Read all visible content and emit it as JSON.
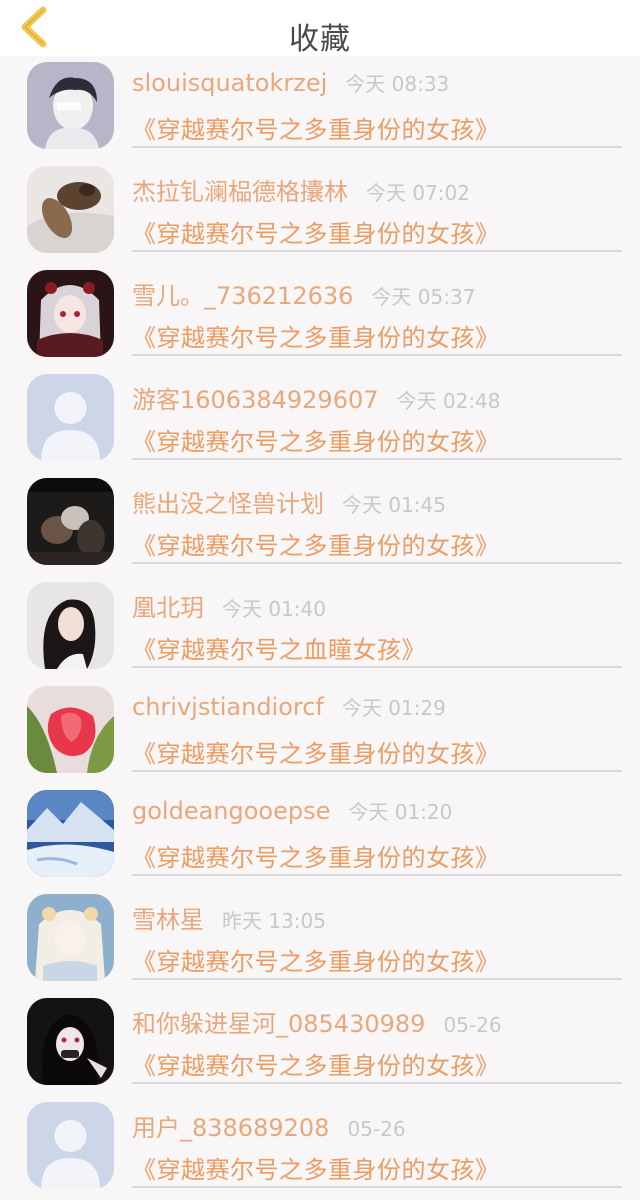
{
  "header": {
    "title": "收藏"
  },
  "favorites": [
    {
      "name": "slouisquatokrzej",
      "time": "今天 08:33",
      "book": "《穿越赛尔号之多重身份的女孩》",
      "avatar": "anime-boy"
    },
    {
      "name": "杰拉钆澜榀德格攮林",
      "time": "今天 07:02",
      "book": "《穿越赛尔号之多重身份的女孩》",
      "avatar": "cat-photo"
    },
    {
      "name": "雪儿。_736212636",
      "time": "今天 05:37",
      "book": "《穿越赛尔号之多重身份的女孩》",
      "avatar": "anime-girl-red"
    },
    {
      "name": "游客1606384929607",
      "time": "今天 02:48",
      "book": "《穿越赛尔号之多重身份的女孩》",
      "avatar": "default-user"
    },
    {
      "name": "熊出没之怪兽计划",
      "time": "今天 01:45",
      "book": "《穿越赛尔号之多重身份的女孩》",
      "avatar": "movie-still"
    },
    {
      "name": "凰北玥",
      "time": "今天 01:40",
      "book": "《穿越赛尔号之血瞳女孩》",
      "avatar": "girl-photo"
    },
    {
      "name": "chrivjstiandiorcf",
      "time": "今天 01:29",
      "book": "《穿越赛尔号之多重身份的女孩》",
      "avatar": "tulip"
    },
    {
      "name": "goldeangooepse",
      "time": "今天 01:20",
      "book": "《穿越赛尔号之多重身份的女孩》",
      "avatar": "snow-landscape"
    },
    {
      "name": "雪林星",
      "time": "昨天 13:05",
      "book": "《穿越赛尔号之多重身份的女孩》",
      "avatar": "anime-girl-pale"
    },
    {
      "name": "和你躲进星河_085430989",
      "time": "05-26",
      "book": "《穿越赛尔号之多重身份的女孩》",
      "avatar": "anime-girl-dark"
    },
    {
      "name": "用户_838689208",
      "time": "05-26",
      "book": "《穿越赛尔号之多重身份的女孩》",
      "avatar": "default-user"
    }
  ]
}
